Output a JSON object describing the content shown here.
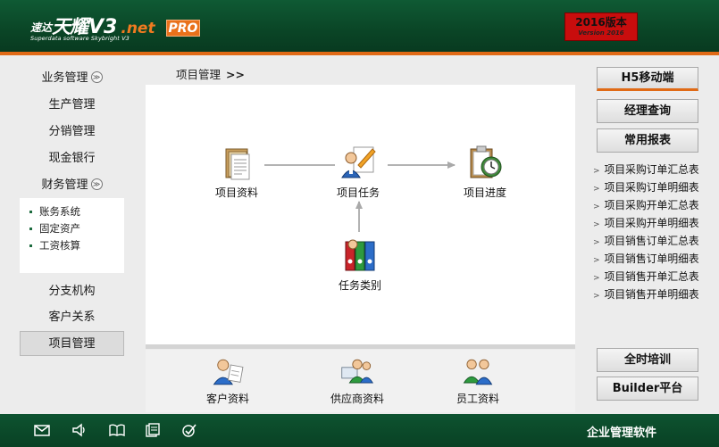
{
  "header": {
    "logo_cn_small": "速达",
    "logo_cn_big": "天耀",
    "logo_v3": "V3",
    "logo_net": ".net",
    "logo_pro": "PRO",
    "logo_sub": "Superdata software Skybright V3",
    "version_year": "2016版本",
    "version_sub": "Version 2016",
    "colors": {
      "brand_green": "#0a4526",
      "accent_orange": "#e06a16",
      "badge_red": "#c80d0d"
    }
  },
  "sidebar": {
    "items": [
      {
        "label": "业务管理",
        "collapsible": true
      },
      {
        "label": "生产管理"
      },
      {
        "label": "分销管理"
      },
      {
        "label": "现金银行"
      },
      {
        "label": "财务管理",
        "collapsible": true
      },
      {
        "label": "分支机构"
      },
      {
        "label": "客户关系"
      },
      {
        "label": "项目管理",
        "active": true
      }
    ],
    "toggle_glyph": "≫",
    "finance_sub": [
      "账务系统",
      "固定资产",
      "工资核算"
    ]
  },
  "main": {
    "breadcrumb": "项目管理",
    "breadcrumb_arrow": ">>",
    "flow": {
      "nodes": [
        {
          "label": "项目资料",
          "icon": "document-stack-icon"
        },
        {
          "label": "项目任务",
          "icon": "person-task-icon"
        },
        {
          "label": "项目进度",
          "icon": "clipboard-clock-icon"
        },
        {
          "label": "任务类别",
          "icon": "binders-icon"
        }
      ]
    },
    "bottom": [
      {
        "label": "客户资料",
        "icon": "customer-icon"
      },
      {
        "label": "供应商资料",
        "icon": "supplier-icon"
      },
      {
        "label": "员工资料",
        "icon": "employees-icon"
      }
    ]
  },
  "right": {
    "buttons_top": [
      "H5移动端",
      "经理查询",
      "常用报表"
    ],
    "reports": [
      "项目采购订单汇总表",
      "项目采购订单明细表",
      "项目采购开单汇总表",
      "项目采购开单明细表",
      "项目销售订单汇总表",
      "项目销售订单明细表",
      "项目销售开单汇总表",
      "项目销售开单明细表"
    ],
    "buttons_bottom": [
      "全时培训",
      "Builder平台"
    ]
  },
  "footer": {
    "icons": [
      "mail-icon",
      "speaker-icon",
      "book-icon",
      "document-icon",
      "check-icon"
    ],
    "text": "企业管理软件"
  }
}
